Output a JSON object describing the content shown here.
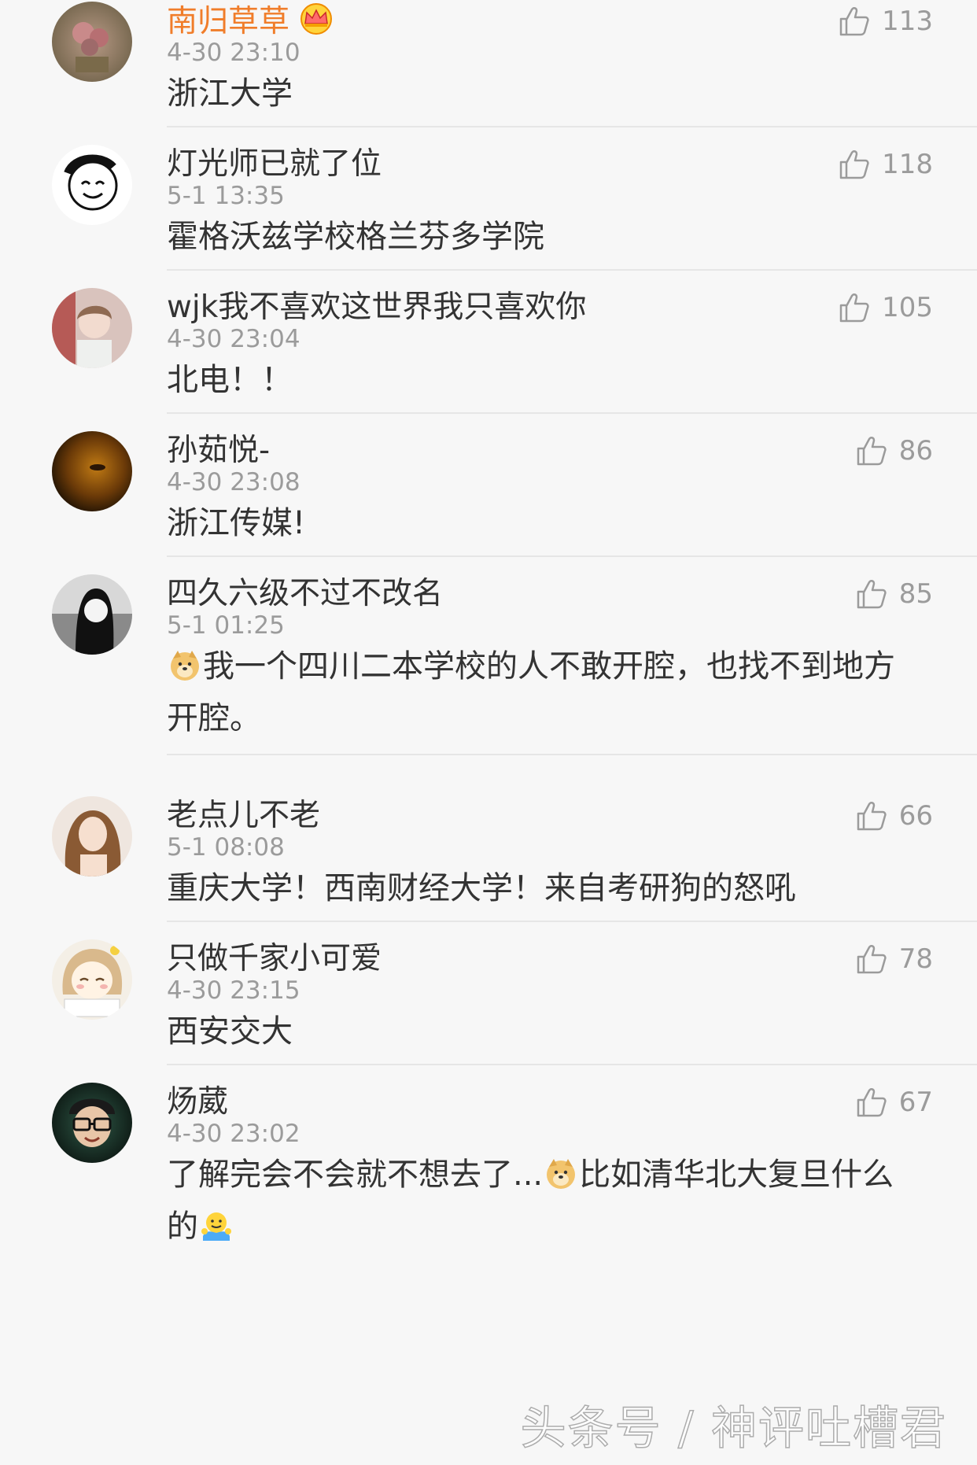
{
  "comments": [
    {
      "username": "南归草草",
      "time": "4-30 23:10",
      "text": "浙江大学",
      "likes": "113"
    },
    {
      "username": "灯光师已就了位",
      "time": "5-1 13:35",
      "text": "霍格沃兹学校格兰芬多学院",
      "likes": "118"
    },
    {
      "username": "wjk我不喜欢这世界我只喜欢你",
      "time": "4-30 23:04",
      "text": "北电！！",
      "likes": "105"
    },
    {
      "username": "孙茹悦-",
      "time": "4-30 23:08",
      "text": "浙江传媒!",
      "likes": "86"
    },
    {
      "username": "四久六级不过不改名",
      "time": "5-1 01:25",
      "text": "我一个四川二本学校的人不敢开腔，也找不到地方开腔。",
      "likes": "85"
    },
    {
      "username": "老点儿不老",
      "time": "5-1 08:08",
      "text": "重庆大学！西南财经大学！来自考研狗的怒吼",
      "likes": "66"
    },
    {
      "username": "只做千家小可爱",
      "time": "4-30 23:15",
      "text": "西安交大",
      "likes": "78"
    },
    {
      "username": "炀葳",
      "time": "4-30 23:02",
      "text_part1": "了解完会不会就不想去了...",
      "text_part2": "比如清华北大复旦什么的",
      "likes": "67"
    }
  ],
  "watermark": "头条号 / 神评吐槽君",
  "icons": {
    "like": "thumbs-up-icon",
    "vip": "crown-icon",
    "emoji_doge": "doge-emoji",
    "emoji_shrug": "shrug-emoji"
  },
  "colors": {
    "vip_username": "#f07d2a",
    "username": "#333333",
    "meta": "#9b9b9b",
    "background": "#f7f7f7"
  }
}
